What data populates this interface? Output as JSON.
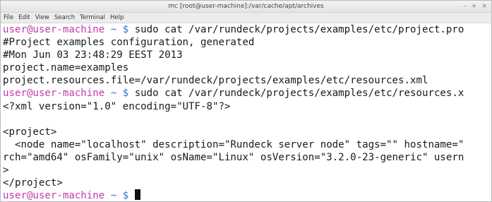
{
  "window": {
    "title": "mc [root@user-machine]:/var/cache/apt/archives",
    "controls": {
      "minimize": "–",
      "maximize": "+",
      "close": "×"
    }
  },
  "menubar": {
    "items": [
      "File",
      "Edit",
      "View",
      "Search",
      "Terminal",
      "Help"
    ]
  },
  "terminal": {
    "prompt": {
      "user_host": "user@user-machine",
      "dir_symbol": " ~ $"
    },
    "lines": [
      {
        "type": "prompt",
        "command": " sudo cat /var/rundeck/projects/examples/etc/project.pro"
      },
      {
        "type": "text",
        "text": "#Project examples configuration, generated"
      },
      {
        "type": "text",
        "text": "#Mon Jun 03 23:48:29 EEST 2013"
      },
      {
        "type": "text",
        "text": "project.name=examples"
      },
      {
        "type": "text",
        "text": "project.resources.file=/var/rundeck/projects/examples/etc/resources.xml"
      },
      {
        "type": "prompt",
        "command": " sudo cat /var/rundeck/projects/examples/etc/resources.x"
      },
      {
        "type": "text",
        "text": "<?xml version=\"1.0\" encoding=\"UTF-8\"?>"
      },
      {
        "type": "text",
        "text": ""
      },
      {
        "type": "text",
        "text": "<project>"
      },
      {
        "type": "text",
        "text": "  <node name=\"localhost\" description=\"Rundeck server node\" tags=\"\" hostname=\""
      },
      {
        "type": "text",
        "text": "rch=\"amd64\" osFamily=\"unix\" osName=\"Linux\" osVersion=\"3.2.0-23-generic\" usern"
      },
      {
        "type": "text",
        "text": ">"
      },
      {
        "type": "text",
        "text": "</project>"
      },
      {
        "type": "prompt",
        "command": " ",
        "cursor": true
      }
    ]
  }
}
